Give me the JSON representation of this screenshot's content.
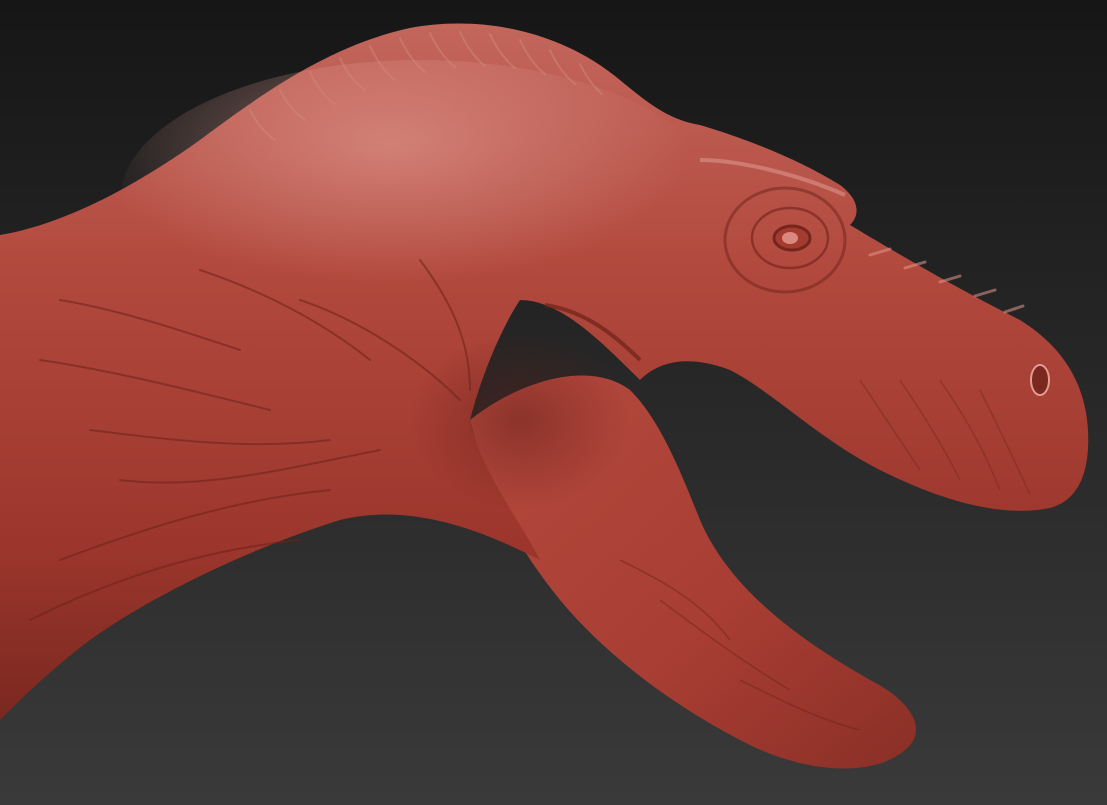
{
  "scene": {
    "subject": "dinosaur-head-sculpt",
    "view": "side-profile-facing-right",
    "mouth": "open",
    "material_color": "#b3463b",
    "material_highlight": "#d98a7f",
    "material_shadow": "#5e1a14",
    "background_top": "#161616",
    "background_bottom": "#3a3a3a"
  }
}
